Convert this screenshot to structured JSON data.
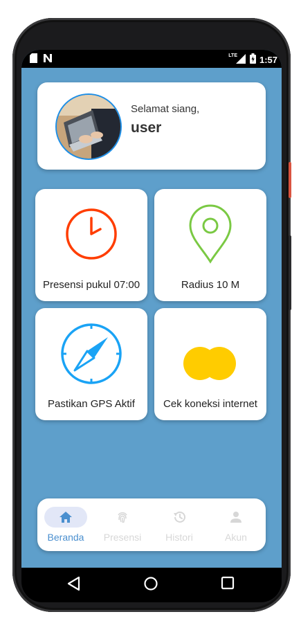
{
  "status_bar": {
    "left_icons": [
      "sim-card-icon",
      "network-n-icon"
    ],
    "lte_label": "LTE",
    "time": "1:57"
  },
  "greeting": {
    "salutation": "Selamat siang,",
    "username": "user",
    "avatar_icon": "avatar-laptop-photo"
  },
  "tiles": [
    {
      "label": "Presensi pukul 07:00",
      "icon": "clock-icon",
      "color": "#ff3d00"
    },
    {
      "label": "Radius 10 M",
      "icon": "location-pin-icon",
      "color": "#7ac943"
    },
    {
      "label": "Pastikan GPS Aktif",
      "icon": "compass-icon",
      "color": "#1aa3f5"
    },
    {
      "label": "Cek koneksi internet",
      "icon": "connection-circles-icon",
      "color": "#ffcc00"
    }
  ],
  "bottom_nav": {
    "items": [
      {
        "label": "Beranda",
        "icon": "home-icon",
        "active": true
      },
      {
        "label": "Presensi",
        "icon": "fingerprint-icon",
        "active": false
      },
      {
        "label": "Histori",
        "icon": "history-icon",
        "active": false
      },
      {
        "label": "Akun",
        "icon": "person-icon",
        "active": false
      }
    ],
    "active_color": "#4a8fcf",
    "inactive_color": "#d7d7d7"
  },
  "colors": {
    "background": "#5e9fcb",
    "card": "#ffffff",
    "avatar_ring": "#1d8fe8"
  }
}
